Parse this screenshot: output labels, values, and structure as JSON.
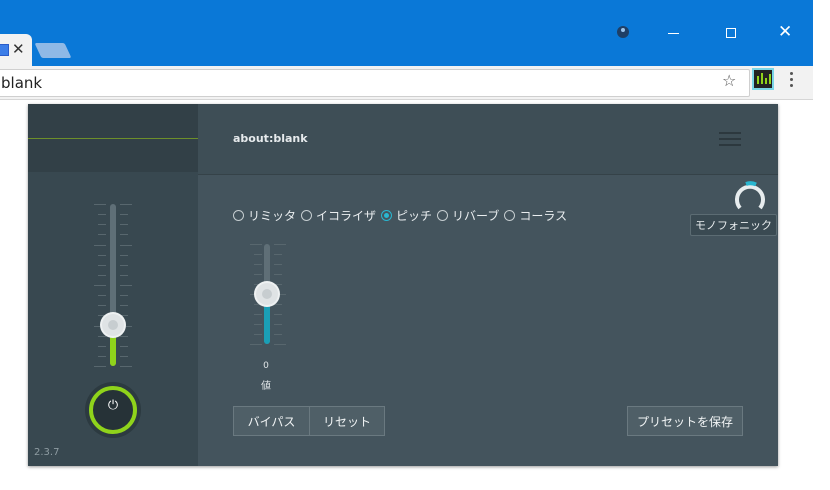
{
  "browser": {
    "tab_close": "✕",
    "address": "blank",
    "bookmark_star": "☆",
    "window_close": "✕",
    "icons": [
      "profile-icon",
      "minimize-icon",
      "maximize-icon",
      "close-icon",
      "star-icon",
      "extension-icon",
      "menu-icon"
    ]
  },
  "popup": {
    "url": "about:blank",
    "version": "2.3.7",
    "power_symbol": "⏻",
    "master_volume": 0.25,
    "effects": [
      {
        "label": "リミッタ",
        "selected": false
      },
      {
        "label": "イコライザ",
        "selected": false
      },
      {
        "label": "ピッチ",
        "selected": true
      },
      {
        "label": "リバーブ",
        "selected": false
      },
      {
        "label": "コーラス",
        "selected": false
      }
    ],
    "mono_label": "モノフォニック",
    "pitch_value": "0",
    "pitch_caption": "値",
    "buttons": {
      "bypass": "バイパス",
      "reset": "リセット",
      "save_preset": "プリセットを保存"
    },
    "colors": {
      "accent_green": "#8fd31b",
      "accent_cyan": "#29b6d0",
      "panel": "#44545d"
    }
  }
}
